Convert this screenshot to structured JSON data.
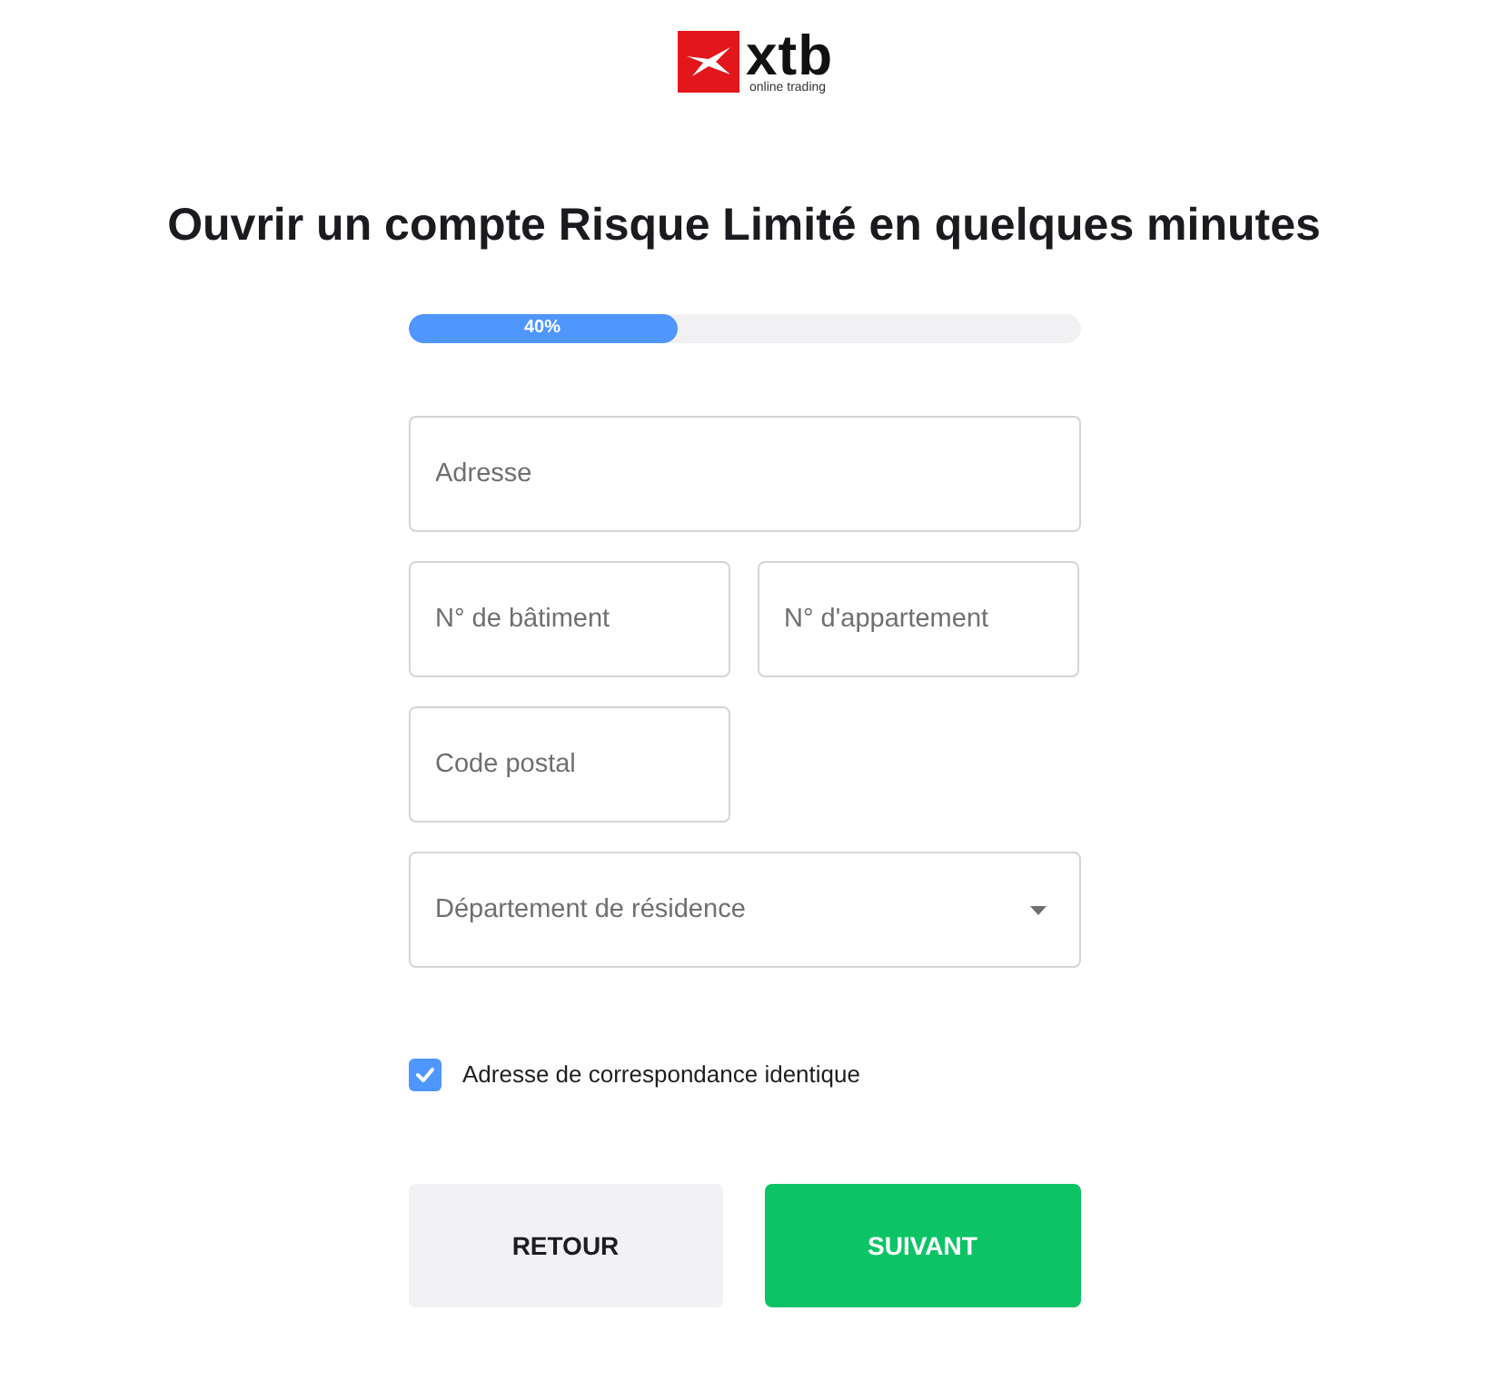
{
  "logo": {
    "wordmark": "xtb",
    "tagline": "online trading"
  },
  "title": "Ouvrir un compte Risque Limité en quelques minutes",
  "progress": {
    "level": 0.4,
    "label": "40%"
  },
  "field_rows": [
    [
      {
        "kind": "wide",
        "placeholder": "Adresse"
      }
    ],
    [
      {
        "kind": "short",
        "placeholder": "N° de bâtiment"
      },
      {
        "kind": "short",
        "placeholder": "N° d'appartement"
      }
    ],
    [
      {
        "kind": "short",
        "placeholder": "Code postal"
      }
    ],
    [
      {
        "kind": "select",
        "placeholder": "Département de résidence"
      }
    ]
  ],
  "same_address": {
    "checked": true,
    "label": "Adresse de correspondance identique"
  },
  "buttons": [
    {
      "kind": "secondary",
      "label": "RETOUR"
    },
    {
      "kind": "primary",
      "label": "SUIVANT"
    }
  ]
}
